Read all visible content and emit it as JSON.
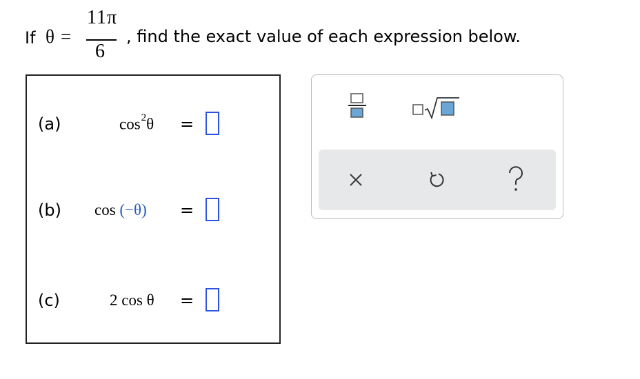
{
  "problem": {
    "prefix": "If",
    "variable": "θ",
    "equals": "=",
    "numerator": "11π",
    "denominator": "6",
    "instruction": ", find the exact value of each expression below."
  },
  "parts": [
    {
      "label": "(a)",
      "expression_func": "cos",
      "expression_exp": "2",
      "expression_arg": "θ",
      "equals": "="
    },
    {
      "label": "(b)",
      "expression_func": "cos",
      "expression_arg": "(−θ)",
      "equals": "="
    },
    {
      "label": "(c)",
      "expression_func": "2 cos",
      "expression_arg": "θ",
      "equals": "="
    }
  ],
  "toolbox": {
    "tools": [
      "fraction-icon",
      "square-root-icon"
    ],
    "actions": [
      "clear-icon",
      "undo-icon",
      "help-icon"
    ],
    "colors": {
      "accent": "#2b52e0",
      "icon_fill": "#6aa6d6",
      "panel_bg": "#e6e8ea"
    }
  }
}
